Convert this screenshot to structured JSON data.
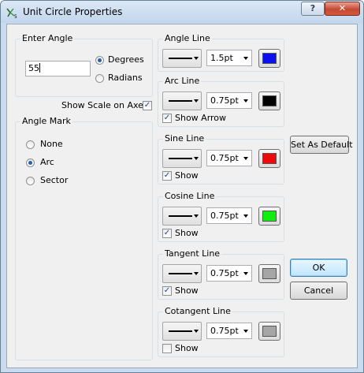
{
  "window": {
    "title": "Unit Circle Properties",
    "help_label": "?",
    "close_label": "✕"
  },
  "enter_angle": {
    "label": "Enter Angle",
    "value": "55",
    "unit_options": [
      {
        "label": "Degrees",
        "selected": true
      },
      {
        "label": "Radians",
        "selected": false
      }
    ]
  },
  "show_scale": {
    "label": "Show Scale on Axes",
    "checked": true
  },
  "angle_mark": {
    "label": "Angle Mark",
    "options": [
      {
        "label": "None",
        "selected": false
      },
      {
        "label": "Arc",
        "selected": true
      },
      {
        "label": "Sector",
        "selected": false
      }
    ]
  },
  "lines": [
    {
      "label": "Angle Line",
      "width": "1.5pt",
      "color": "#0a10ee",
      "show_label": "",
      "show_checked": null
    },
    {
      "label": "Arc Line",
      "width": "0.75pt",
      "color": "#000000",
      "show_label": "Show Arrow",
      "show_checked": true
    },
    {
      "label": "Sine Line",
      "width": "0.75pt",
      "color": "#ee0a0a",
      "show_label": "Show",
      "show_checked": true
    },
    {
      "label": "Cosine Line",
      "width": "0.75pt",
      "color": "#0fee0f",
      "show_label": "Show",
      "show_checked": true
    },
    {
      "label": "Tangent Line",
      "width": "0.75pt",
      "color": "#a6a6a6",
      "show_label": "Show",
      "show_checked": true
    },
    {
      "label": "Cotangent Line",
      "width": "0.75pt",
      "color": "#a6a6a6",
      "show_label": "Show",
      "show_checked": false
    }
  ],
  "buttons": {
    "set_default": "Set As Default",
    "ok": "OK",
    "cancel": "Cancel"
  }
}
